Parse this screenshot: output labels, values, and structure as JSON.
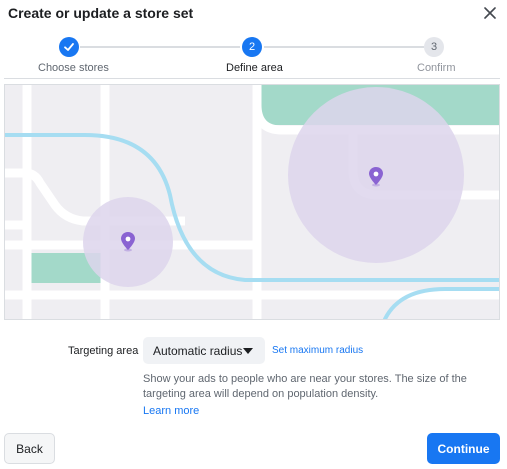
{
  "dialog": {
    "title": "Create or update a store set",
    "close_icon": "close-icon"
  },
  "stepper": {
    "steps": [
      {
        "label": "Choose stores",
        "status": "complete",
        "icon": "checkmark-icon"
      },
      {
        "label": "Define area",
        "status": "active",
        "number": "2"
      },
      {
        "label": "Confirm",
        "status": "pending",
        "number": "3"
      }
    ]
  },
  "map": {
    "pins": [
      "location-pin-icon",
      "location-pin-icon"
    ],
    "colors": {
      "background": "#efeef2",
      "road": "#ffffff",
      "highway": "#a6ddf2",
      "park": "#a3d9c9",
      "radius": "#ddd5ec",
      "pin": "#8a63d2"
    }
  },
  "targeting": {
    "label": "Targeting area",
    "selected_option": "Automatic radius",
    "max_radius_link": "Set maximum radius",
    "help_text": "Show your ads to people who are near your stores. The size of the targeting area will depend on population density.",
    "learn_more": "Learn more"
  },
  "footer": {
    "back_label": "Back",
    "continue_label": "Continue"
  },
  "colors": {
    "accent": "#1877f2",
    "text_primary": "#1c1e21",
    "text_secondary": "#606770",
    "divider": "#dadde1"
  }
}
